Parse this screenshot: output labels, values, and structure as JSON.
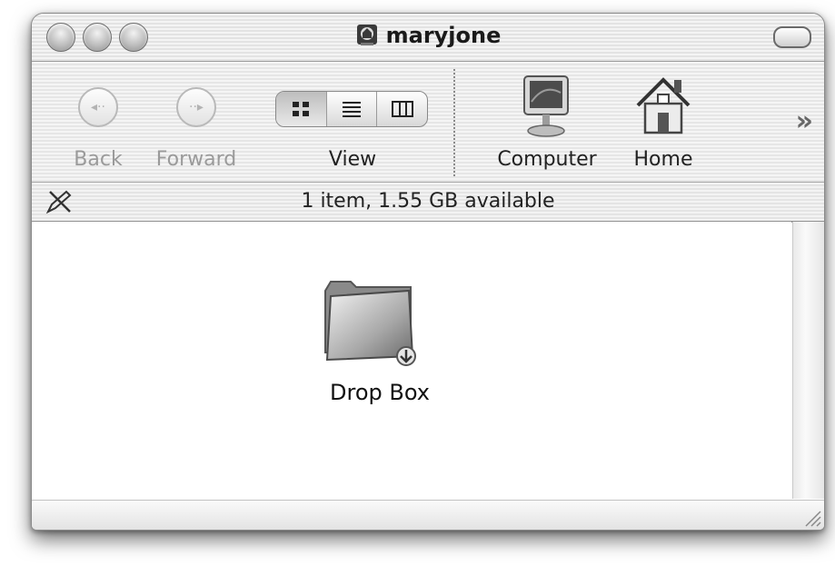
{
  "window": {
    "title": "maryjone"
  },
  "toolbar": {
    "back_label": "Back",
    "forward_label": "Forward",
    "view_label": "View",
    "computer_label": "Computer",
    "home_label": "Home",
    "overflow": "»"
  },
  "status": {
    "text": "1 item, 1.55 GB available"
  },
  "items": [
    {
      "name": "Drop Box",
      "icon": "drop-box-folder-icon"
    }
  ]
}
